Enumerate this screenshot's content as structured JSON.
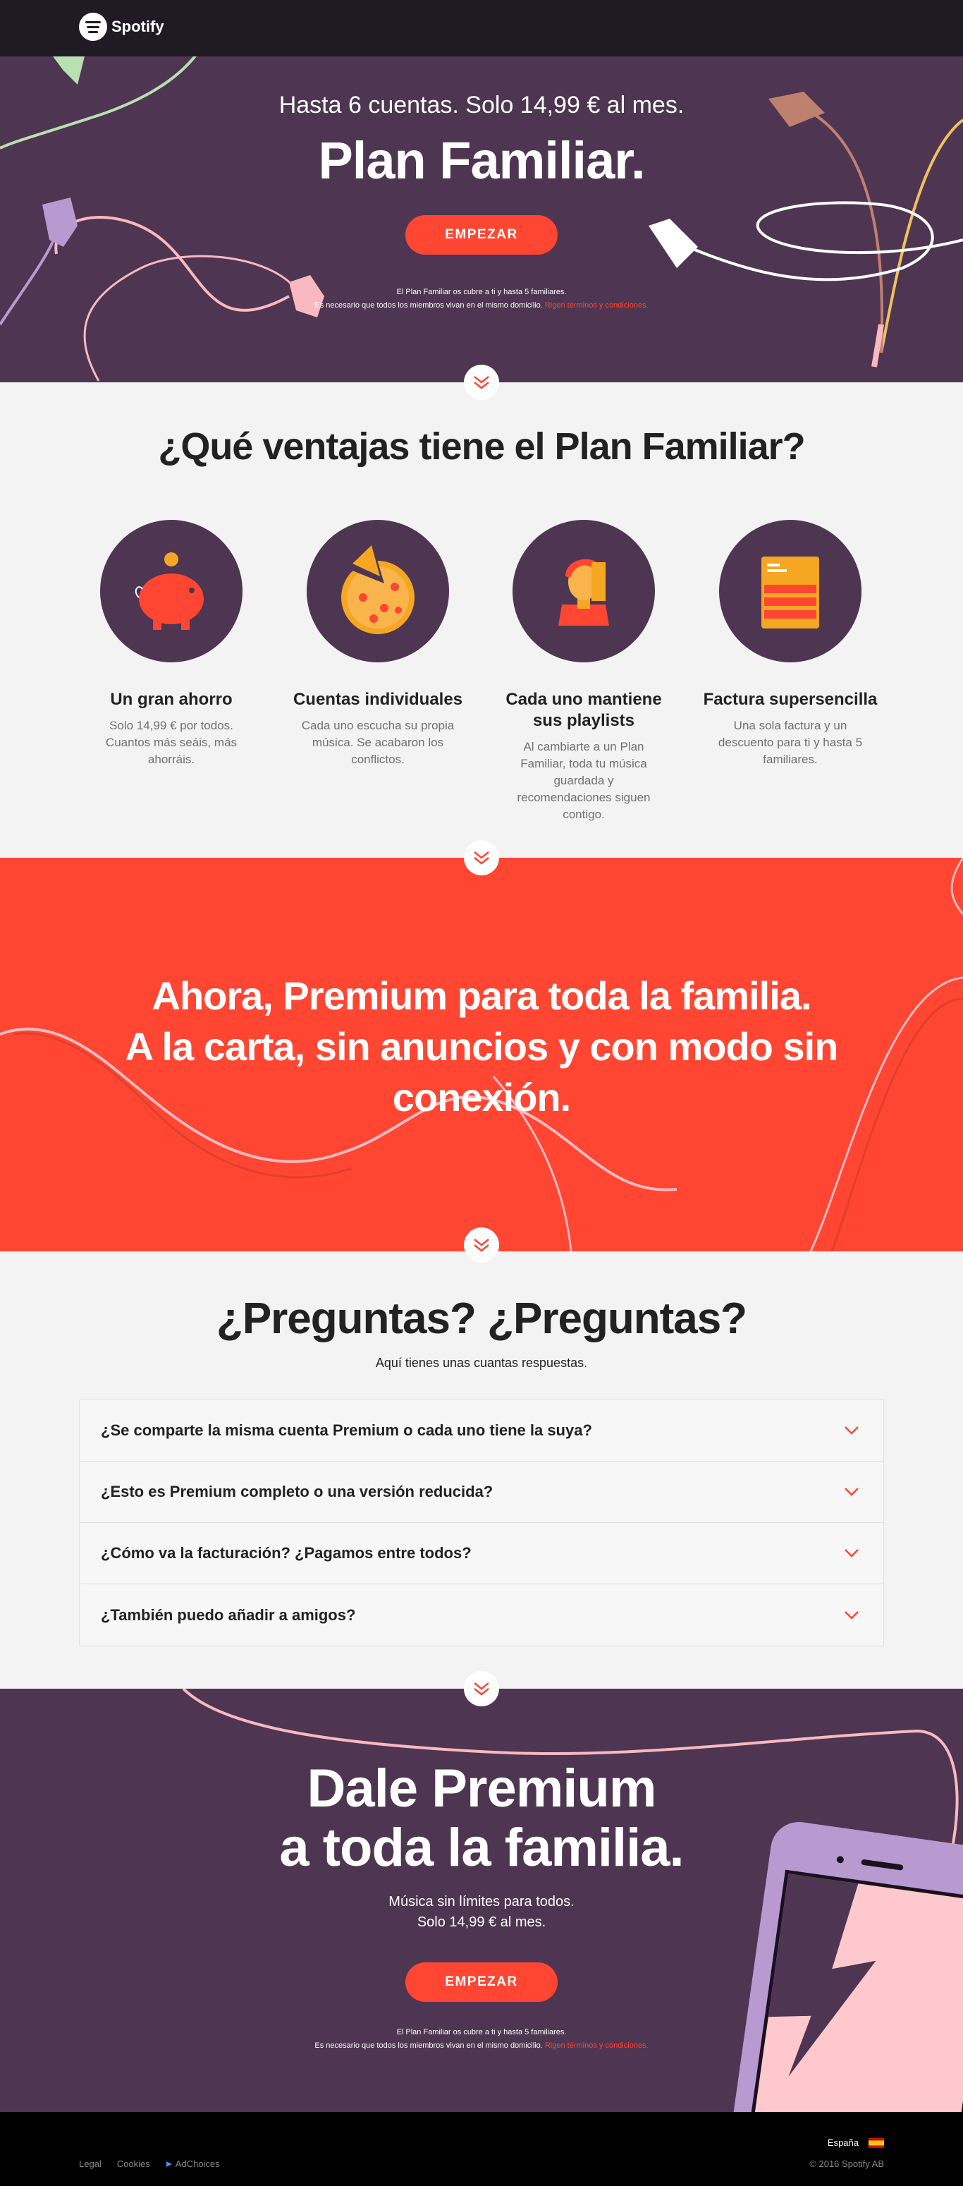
{
  "header": {
    "brand": "Spotify"
  },
  "hero": {
    "subtitle": "Hasta 6 cuentas. Solo 14,99 € al mes.",
    "title": "Plan Familiar.",
    "cta": "EMPEZAR",
    "note_line1": "El Plan Familiar os cubre a ti y hasta 5 familiares.",
    "note_line2": "Es necesario que todos los miembros vivan en el mismo domicilio.",
    "note_link": "Rigen términos y condiciones."
  },
  "benefits": {
    "heading": "¿Qué ventajas tiene el Plan Familiar?",
    "items": [
      {
        "icon": "piggy-bank-icon",
        "title": "Un gran ahorro",
        "text": "Solo 14,99 € por todos. Cuantos más seáis, más ahorráis."
      },
      {
        "icon": "pizza-icon",
        "title": "Cuentas individuales",
        "text": "Cada uno escucha su propia música. Se acabaron los conflictos."
      },
      {
        "icon": "person-icon",
        "title": "Cada uno mantiene sus playlists",
        "text": "Al cambiarte a un Plan Familiar, toda tu música guardada y recomendaciones siguen contigo."
      },
      {
        "icon": "invoice-icon",
        "title": "Factura supersencilla",
        "text": "Una sola factura y un descuento para ti y hasta 5 familiares."
      }
    ]
  },
  "promo": {
    "line1": "Ahora, Premium para toda la familia.",
    "line2": "A la carta, sin anuncios y con modo sin",
    "line3": "conexión."
  },
  "faq": {
    "heading": "¿Preguntas? ¿Preguntas?",
    "lead": "Aquí tienes unas cuantas respuestas.",
    "items": [
      "¿Se comparte la misma cuenta Premium o cada uno tiene la suya?",
      "¿Esto es Premium completo o una versión reducida?",
      "¿Cómo va la facturación? ¿Pagamos entre todos?",
      "¿También puedo añadir a amigos?"
    ]
  },
  "bottom": {
    "title_line1": "Dale Premium",
    "title_line2": "a toda la familia.",
    "msg_line1": "Música sin límites para todos.",
    "msg_line2": "Solo 14,99 € al mes.",
    "cta": "EMPEZAR",
    "note_line1": "El Plan Familiar os cubre a ti y hasta 5 familiares.",
    "note_line2": "Es necesario que todos los miembros vivan en el mismo domicilio.",
    "note_link": "Rigen términos y condiciones."
  },
  "footer": {
    "links": [
      "Legal",
      "Cookies",
      "AdChoices"
    ],
    "country": "España",
    "copyright": "© 2016 Spotify AB"
  },
  "colors": {
    "purple": "#4e3551",
    "accent": "#ff4632",
    "light": "#f3f3f3"
  }
}
